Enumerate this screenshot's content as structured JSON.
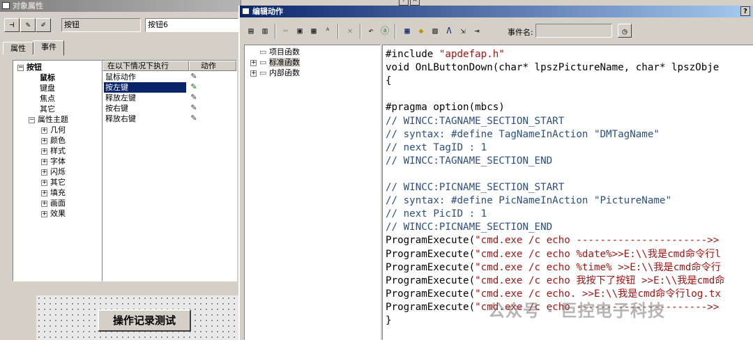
{
  "object_properties": {
    "title": "对象属性",
    "toolbar_icons": [
      "pin-icon",
      "pipette-icon",
      "pipette-icon"
    ],
    "object_type": "按钮",
    "object_name": "按钮6",
    "tabs": [
      "属性",
      "事件"
    ],
    "selected_tab": "事件",
    "tree": {
      "root": "按钮",
      "children": [
        "鼠标",
        "键盘",
        "焦点",
        "其它"
      ],
      "group": "属性主题",
      "group_children": [
        "几何",
        "颜色",
        "样式",
        "字体",
        "闪烁",
        "其它",
        "填充",
        "画面",
        "效果"
      ]
    },
    "event_header": "在以下情况下执行",
    "action_header": "动作",
    "events": [
      "鼠标动作",
      "按左键",
      "释放左键",
      "按右键",
      "释放右键"
    ],
    "selected_event": "按左键"
  },
  "canvas": {
    "button_label": "操作记录测试"
  },
  "editor": {
    "title": "编辑动作",
    "event_name_label": "事件名:",
    "event_name_value": "",
    "function_tree": [
      "项目函数",
      "标准函数",
      "内部函数"
    ],
    "code_lines": [
      [
        {
          "t": "#include ",
          "c": "pp"
        },
        {
          "t": "\"apdefap.h\"",
          "c": "str"
        }
      ],
      [
        {
          "t": "void OnLButtonDown(char* lpszPictureName, char* lpszObje",
          "c": "kw"
        }
      ],
      [
        {
          "t": "{",
          "c": "kw"
        }
      ],
      [
        {
          "t": "",
          "c": "kw"
        }
      ],
      [
        {
          "t": "#pragma option(mbcs)",
          "c": "pp"
        }
      ],
      [
        {
          "t": "// WINCC:TAGNAME_SECTION_START",
          "c": "cmt"
        }
      ],
      [
        {
          "t": "// syntax: #define TagNameInAction \"DMTagName\"",
          "c": "cmt"
        }
      ],
      [
        {
          "t": "// next TagID : 1",
          "c": "cmt"
        }
      ],
      [
        {
          "t": "// WINCC:TAGNAME_SECTION_END",
          "c": "cmt"
        }
      ],
      [
        {
          "t": "",
          "c": "kw"
        }
      ],
      [
        {
          "t": "// WINCC:PICNAME_SECTION_START",
          "c": "cmt"
        }
      ],
      [
        {
          "t": "// syntax: #define PicNameInAction \"PictureName\"",
          "c": "cmt"
        }
      ],
      [
        {
          "t": "// next PicID : 1",
          "c": "cmt"
        }
      ],
      [
        {
          "t": "// WINCC:PICNAME_SECTION_END",
          "c": "cmt"
        }
      ],
      [
        {
          "t": "ProgramExecute(",
          "c": "kw"
        },
        {
          "t": "\"cmd.exe /c echo ---------------------->>",
          "c": "str"
        }
      ],
      [
        {
          "t": "ProgramExecute(",
          "c": "kw"
        },
        {
          "t": "\"cmd.exe /c echo %date%>>E:\\\\我是cmd命令行l",
          "c": "str"
        }
      ],
      [
        {
          "t": "ProgramExecute(",
          "c": "kw"
        },
        {
          "t": "\"cmd.exe /c echo %time% >>E:\\\\我是cmd命令行",
          "c": "str"
        }
      ],
      [
        {
          "t": "ProgramExecute(",
          "c": "kw"
        },
        {
          "t": "\"cmd.exe /c echo 我按下了按钮 >>E:\\\\我是cmd命",
          "c": "str"
        }
      ],
      [
        {
          "t": "ProgramExecute(",
          "c": "kw"
        },
        {
          "t": "\"cmd.exe /c echo. >>E:\\\\我是cmd命令行log.tx",
          "c": "str"
        }
      ],
      [
        {
          "t": "ProgramExecute(",
          "c": "kw"
        },
        {
          "t": "\"cmd.exe /c echo ---------------------->>",
          "c": "str"
        }
      ],
      [
        {
          "t": "}",
          "c": "kw"
        }
      ]
    ]
  },
  "watermark": "公众号 · 巨控电子科技"
}
